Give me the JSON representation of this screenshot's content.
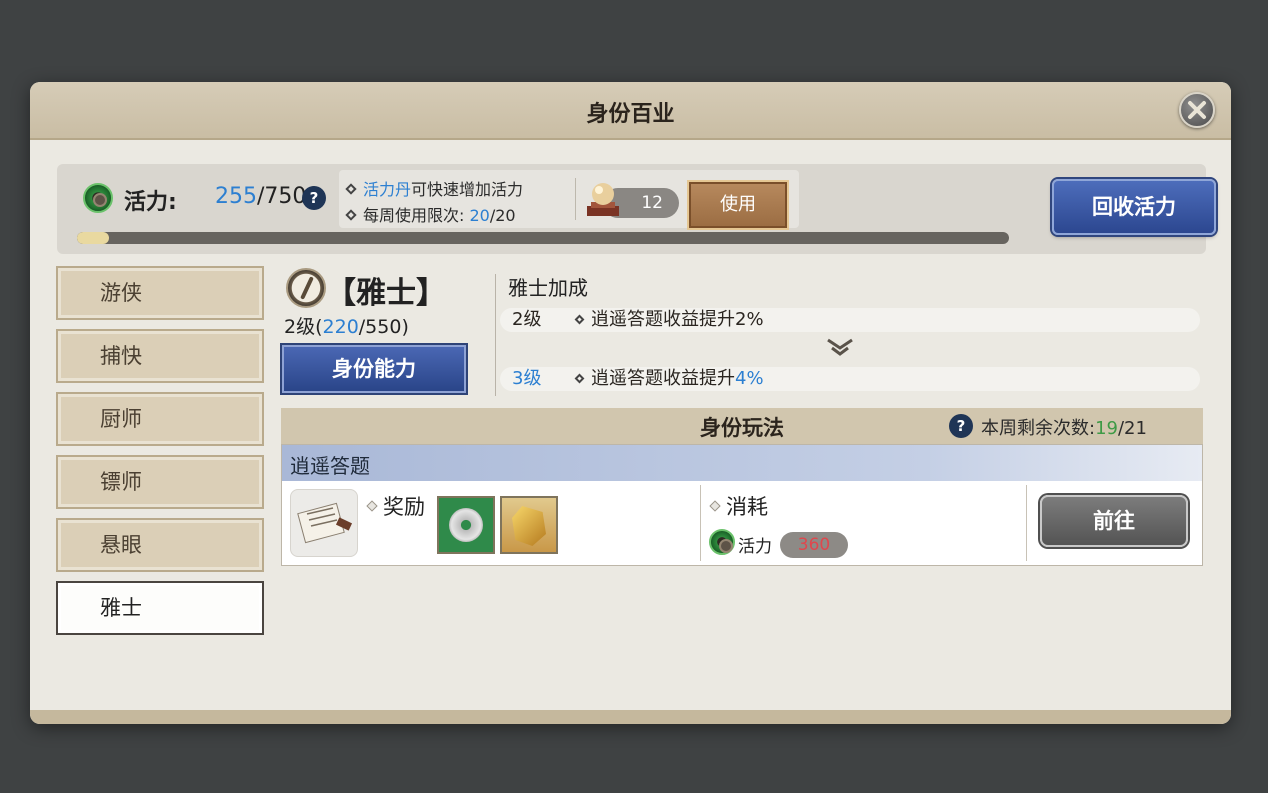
{
  "window": {
    "title": "身份百业"
  },
  "energy": {
    "label": "活力:",
    "current": "255",
    "separator_max": "/7500",
    "progress_fraction": 0.034,
    "tip_line1_highlight": "活力丹",
    "tip_line1_rest": "可快速增加活力",
    "tip_line2_label": "每周使用限次: ",
    "tip_line2_used": "20",
    "tip_line2_max": "/20",
    "item_count": "12",
    "use_button": "使用",
    "recover_button": "回收活力"
  },
  "sidebar": {
    "items": [
      {
        "label": "游侠"
      },
      {
        "label": "捕快"
      },
      {
        "label": "厨师"
      },
      {
        "label": "镖师"
      },
      {
        "label": "悬眼"
      },
      {
        "label": "雅士"
      }
    ],
    "active_index": 5
  },
  "identity": {
    "name": "【雅士】",
    "level_prefix": "2级(",
    "exp_current": "220",
    "exp_max": "/550)",
    "ability_button": "身份能力",
    "bonus_title": "雅士加成",
    "current_bonus_level": "2级",
    "current_bonus_text": "逍遥答题收益提升2%",
    "next_bonus_level": "3级",
    "next_bonus_text_prefix": "逍遥答题收益提升",
    "next_bonus_value": "4%"
  },
  "gameplay": {
    "section_title": "身份玩法",
    "weekly_label": "本周剩余次数:",
    "weekly_remaining": "19",
    "weekly_max": "/21",
    "activity_title": "逍遥答题",
    "reward_label": "奖励",
    "cost_label": "消耗",
    "cost_resource": "活力",
    "cost_value": "360",
    "go_button": "前往"
  },
  "colors": {
    "accent_blue": "#2c7fd1",
    "accent_green": "#3e9a46",
    "cost_red": "#d8353c",
    "button_blue": "#2c4790"
  }
}
